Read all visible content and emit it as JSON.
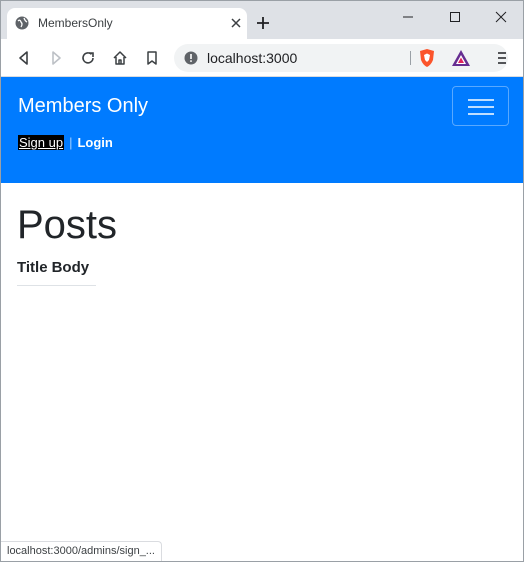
{
  "browser": {
    "tab_title": "MembersOnly",
    "url": "localhost:3000",
    "status_url": "localhost:3000/admins/sign_..."
  },
  "navbar": {
    "brand": "Members Only",
    "signup_label": "Sign up",
    "separator": "|",
    "login_label": "Login",
    "background_color": "#007bff"
  },
  "main": {
    "heading": "Posts",
    "columns": [
      "Title",
      "Body"
    ]
  },
  "icons": {
    "tab": [
      "globe-icon",
      "close-icon",
      "plus-icon"
    ],
    "window": [
      "minimize-icon",
      "maximize-icon",
      "close-icon"
    ],
    "toolbar": [
      "back-icon",
      "forward-icon",
      "reload-icon",
      "home-icon",
      "bookmark-icon",
      "info-icon",
      "brave-shield-icon",
      "brave-rewards-icon",
      "menu-icon"
    ]
  }
}
